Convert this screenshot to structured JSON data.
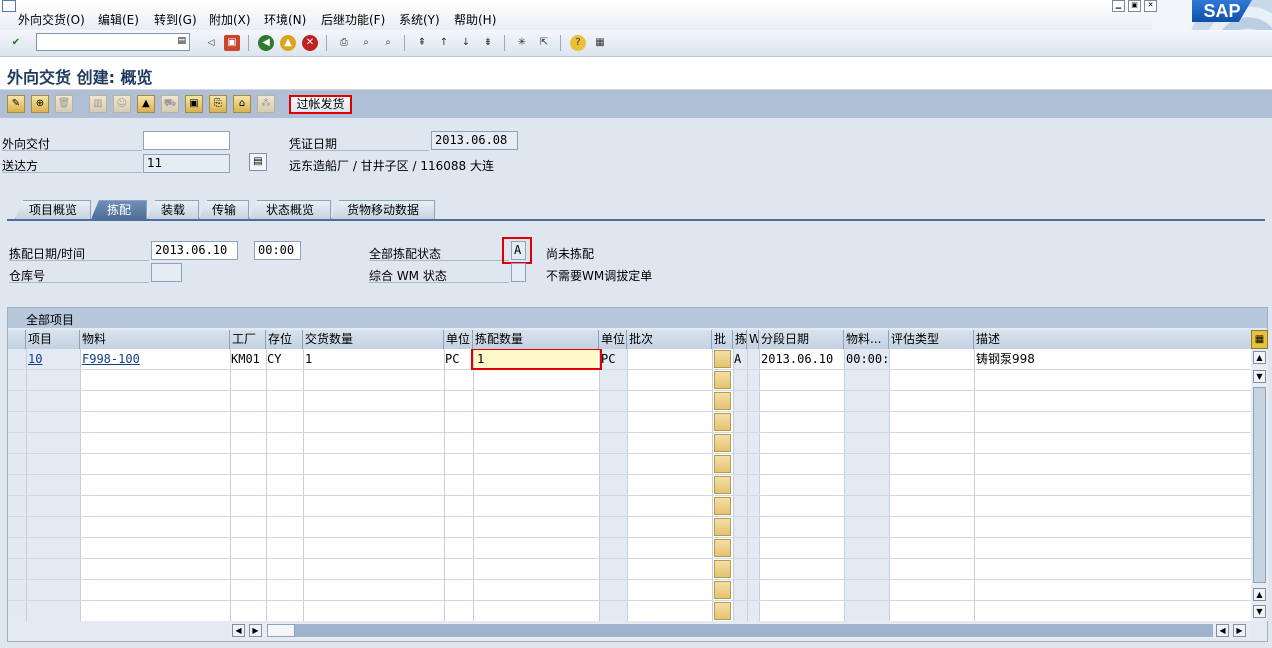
{
  "menu": {
    "items": [
      "外向交货(O)",
      "编辑(E)",
      "转到(G)",
      "附加(X)",
      "环境(N)",
      "后继功能(F)",
      "系统(Y)",
      "帮助(H)"
    ],
    "brand": "SAP"
  },
  "toolbar": {
    "command_value": ""
  },
  "page": {
    "title": "外向交货 创建: 概览"
  },
  "app_toolbar": {
    "post_goods_issue": "过帐发货"
  },
  "header": {
    "outbound_delivery_label": "外向交付",
    "outbound_delivery_value": "",
    "ship_to_label": "送达方",
    "ship_to_value": "11",
    "ship_to_desc": "远东造船厂 / 甘井子区 / 116088 大连",
    "doc_date_label": "凭证日期",
    "doc_date_value": "2013.06.08"
  },
  "tabs": [
    "项目概览",
    "拣配",
    "装载",
    "传输",
    "状态概览",
    "货物移动数据"
  ],
  "picking": {
    "date_time_label": "拣配日期/时间",
    "date_value": "2013.06.10",
    "time_value": "00:00",
    "warehouse_label": "仓库号",
    "warehouse_value": "",
    "status_label": "全部拣配状态",
    "status_code": "A",
    "status_text": "尚未拣配",
    "wm_status_label": "综合 WM 状态",
    "wm_status_code": "",
    "wm_status_text": "不需要WM调拔定单"
  },
  "table": {
    "group_title": "全部项目",
    "columns": [
      "项目",
      "物料",
      "工厂",
      "存位",
      "交货数量",
      "单位",
      "拣配数量",
      "单位",
      "批次",
      "批",
      "拣",
      "W",
      "分段日期",
      "物料...",
      "评估类型",
      "描述"
    ],
    "rows": [
      {
        "item": "10",
        "material": "F998-100",
        "plant": "KM01",
        "sloc": "CY",
        "delivery_qty": "1",
        "unit": "PC",
        "pick_qty": "1",
        "pick_unit": "PC",
        "batch": "",
        "pick_status": "A",
        "stage_date": "2013.06.10",
        "mat_time": "00:00:",
        "valuation": "",
        "description": "铸钢泵998"
      }
    ]
  }
}
